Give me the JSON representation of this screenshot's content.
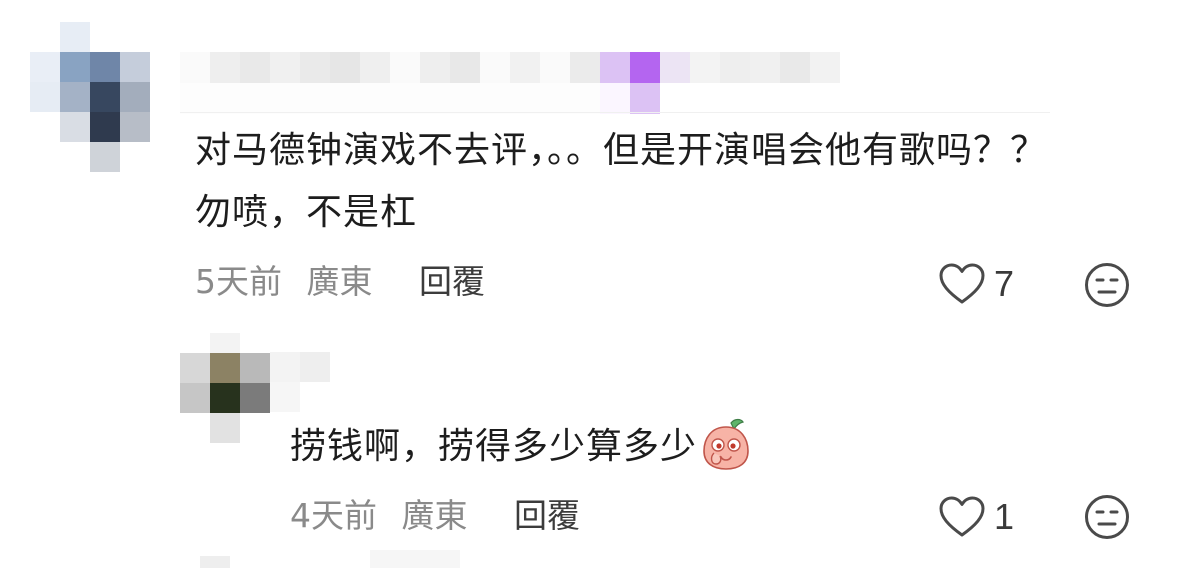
{
  "comments": [
    {
      "text": "对马德钟演戏不去评，。。但是开演唱会他有歌吗？？勿喷，不是杠",
      "time": "5天前",
      "location": "廣東",
      "reply_label": "回覆",
      "likes": "7"
    },
    {
      "text": "捞钱啊，捞得多少算多少",
      "time": "4天前",
      "location": "廣東",
      "reply_label": "回覆",
      "likes": "1"
    }
  ],
  "icons": {
    "like": "heart-outline-icon",
    "reaction": "neutral-face-icon",
    "sticker": "peach-sticker-icon"
  },
  "colors": {
    "text": "#1d1d1d",
    "meta": "#8a8a8a",
    "purple_pixel": "#b465f0"
  }
}
